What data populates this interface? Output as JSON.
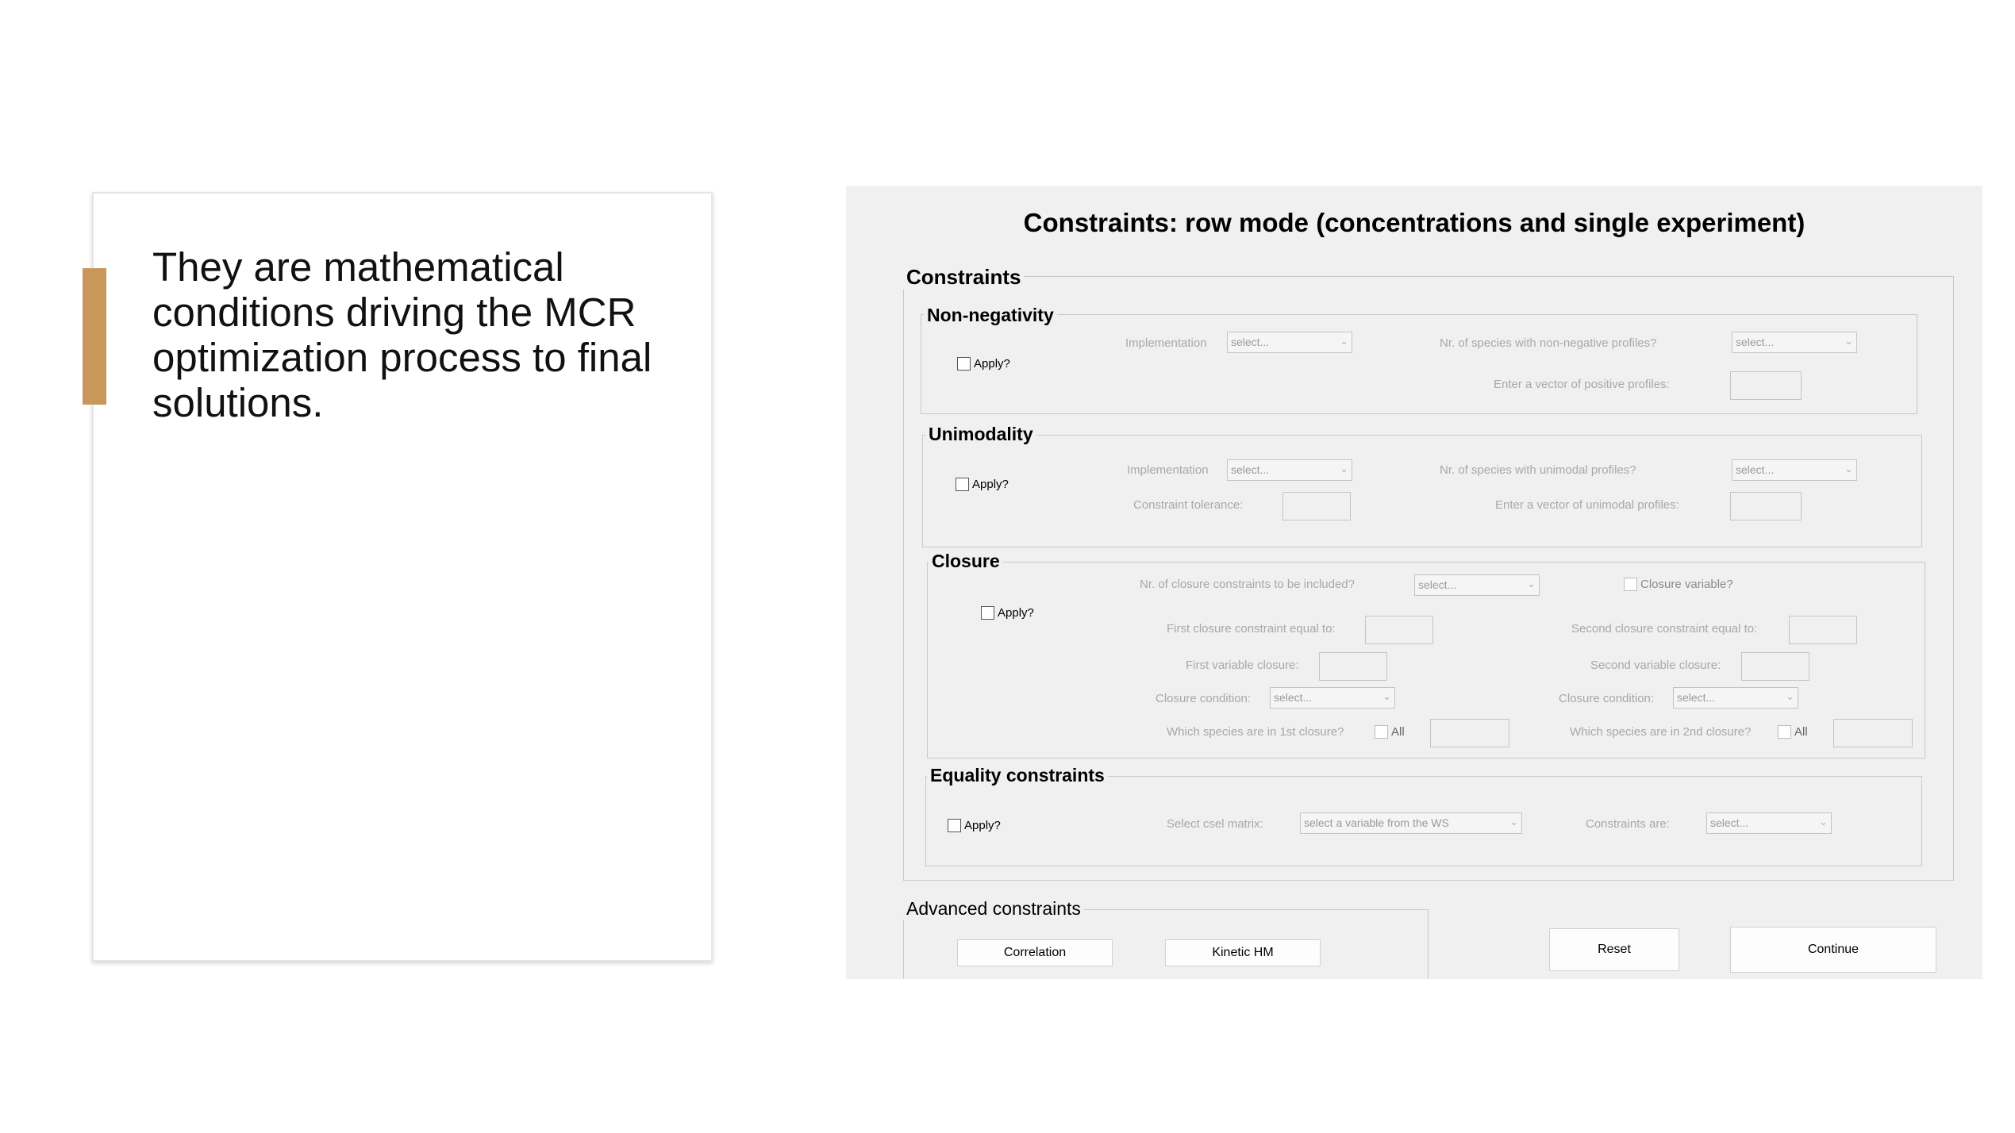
{
  "slide": {
    "text": "They are mathematical conditions driving the MCR optimization process to final solutions.",
    "accent_color": "#c9975a"
  },
  "window": {
    "title": "Constraints: row mode (concentrations and single experiment)",
    "constraints_legend": "Constraints",
    "nonneg": {
      "legend": "Non-negativity",
      "apply": "Apply?",
      "implementation_label": "Implementation",
      "implementation_value": "select...",
      "species_label": "Nr. of species with non-negative profiles?",
      "species_value": "select...",
      "vector_label": "Enter a vector of positive profiles:"
    },
    "unimodality": {
      "legend": "Unimodality",
      "apply": "Apply?",
      "implementation_label": "Implementation",
      "implementation_value": "select...",
      "species_label": "Nr. of species with unimodal profiles?",
      "species_value": "select...",
      "tolerance_label": "Constraint tolerance:",
      "vector_label": "Enter a vector of unimodal profiles:"
    },
    "closure": {
      "legend": "Closure",
      "apply": "Apply?",
      "nr_label": "Nr. of closure constraints to be included?",
      "nr_value": "select...",
      "variable_label": "Closure variable?",
      "first_equal_label": "First closure constraint equal to:",
      "second_equal_label": "Second closure constraint equal to:",
      "first_variable_label": "First variable closure:",
      "second_variable_label": "Second variable closure:",
      "condition1_label": "Closure condition:",
      "condition1_value": "select...",
      "condition2_label": "Closure condition:",
      "condition2_value": "select...",
      "species1_label": "Which species are in 1st closure?",
      "species2_label": "Which species are in 2nd closure?",
      "all1": "All",
      "all2": "All"
    },
    "equality": {
      "legend": "Equality constraints",
      "apply": "Apply?",
      "csel_label": "Select csel matrix:",
      "csel_value": "select a variable from the WS",
      "constraints_label": "Constraints are:",
      "constraints_value": "select..."
    },
    "advanced": {
      "legend": "Advanced constraints",
      "correlation": "Correlation",
      "kinetic": "Kinetic HM"
    },
    "reset": "Reset",
    "continue": "Continue"
  }
}
